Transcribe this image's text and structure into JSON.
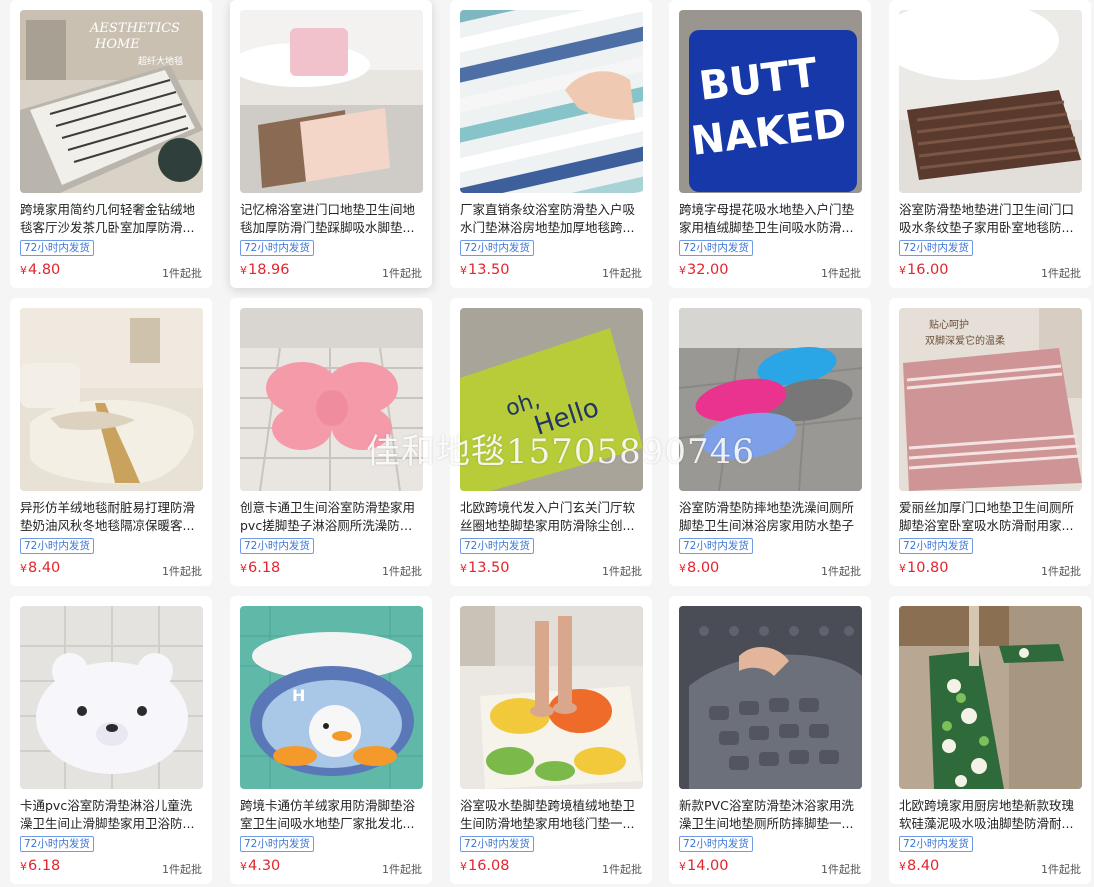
{
  "shipping_badge": "72小时内发货",
  "currency_symbol": "¥",
  "products": [
    {
      "title": "跨境家用简约几何轻奢金钻绒地毯客厅沙发茶几卧室加厚防滑...",
      "price": "4.80",
      "moq": "1件起批",
      "image_text": [
        "AESTHETICS",
        "HOME",
        "超纤大地毯"
      ],
      "image": "geometric-rug-living-room"
    },
    {
      "title": "记忆棉浴室进门口地垫卫生间地毯加厚防滑门垫踩脚吸水脚垫...",
      "price": "18.96",
      "moq": "1件起批",
      "image": "memory-foam-bath-mats"
    },
    {
      "title": "厂家直销条纹浴室防滑垫入户吸水门垫淋浴房地垫加厚地毯跨...",
      "price": "13.50",
      "moq": "1件起批",
      "image": "striped-tufted-mat-hand"
    },
    {
      "title": "跨境字母提花吸水地垫入户门垫家用植绒脚垫卫生间吸水防滑...",
      "price": "32.00",
      "moq": "1件起批",
      "image_text": [
        "BUTT",
        "NAKED"
      ],
      "image": "butt-naked-blue-rug"
    },
    {
      "title": "浴室防滑垫地垫进门卫生间门口吸水条纹垫子家用卧室地毯防...",
      "price": "16.00",
      "moq": "1件起批",
      "image": "brown-striped-bath-mat"
    },
    {
      "title": "异形仿羊绒地毯耐脏易打理防滑垫奶油风秋冬地毯隔凉保暖客...",
      "price": "8.40",
      "moq": "1件起批",
      "image": "cream-irregular-rug"
    },
    {
      "title": "创意卡通卫生间浴室防滑垫家用pvc搓脚垫子淋浴厕所洗澡防摔...",
      "price": "6.18",
      "moq": "1件起批",
      "image": "pink-bow-pvc-mat"
    },
    {
      "title": "北欧跨境代发入户门玄关门厅软丝圈地垫脚垫家用防滑除尘创...",
      "price": "13.50",
      "moq": "1件起批",
      "image_text": [
        "oh,",
        "Hello"
      ],
      "image": "green-coil-doormat"
    },
    {
      "title": "浴室防滑垫防摔地垫洗澡间厕所脚垫卫生间淋浴房家用防水垫子",
      "price": "8.00",
      "moq": "1件起批",
      "image": "colorful-oval-pvc-mats"
    },
    {
      "title": "爱丽丝加厚门口地垫卫生间厕所脚垫浴室卧室吸水防滑耐用家...",
      "price": "10.80",
      "moq": "1件起批",
      "image_text": [
        "贴心呵护",
        "双脚深爱它的温柔"
      ],
      "image": "pink-striped-bath-rug"
    },
    {
      "title": "卡通pvc浴室防滑垫淋浴儿童洗澡卫生间止滑脚垫家用卫浴防...",
      "price": "6.18",
      "moq": "1件起批",
      "image": "bear-face-pvc-mat"
    },
    {
      "title": "跨境卡通仿羊绒家用防滑脚垫浴室卫生间吸水地垫厂家批发北...",
      "price": "4.30",
      "moq": "1件起批",
      "image": "duck-cartoon-rug"
    },
    {
      "title": "浴室吸水垫脚垫跨境植绒地垫卫生间防滑地垫家用地毯门垫一...",
      "price": "16.08",
      "moq": "1件起批",
      "image": "floral-tufted-mat-feet"
    },
    {
      "title": "新款PVC浴室防滑垫沐浴家用洗澡卫生间地垫厕所防摔脚垫一...",
      "price": "14.00",
      "moq": "1件起批",
      "image": "grey-pvc-suction-mat"
    },
    {
      "title": "北欧跨境家用厨房地垫新款玫瑰软硅藻泥吸水吸油脚垫防滑耐...",
      "price": "8.40",
      "moq": "1件起批",
      "image": "green-floral-kitchen-runner"
    }
  ],
  "watermark": "佳和地毯15705890746"
}
